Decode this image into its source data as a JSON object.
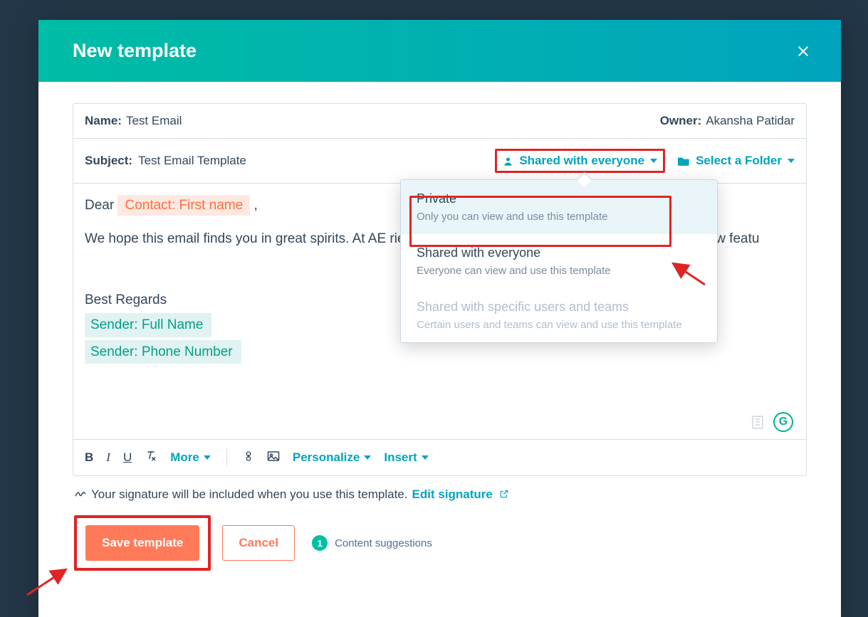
{
  "header": {
    "title": "New template"
  },
  "fields": {
    "name_label": "Name:",
    "name_value": "Test Email",
    "owner_label": "Owner:",
    "owner_value": "Akansha Patidar",
    "subject_label": "Subject:",
    "subject_value": "Test Email Template"
  },
  "sharing": {
    "current": "Shared with everyone",
    "folder_label": "Select a Folder",
    "options": [
      {
        "title": "Private",
        "desc": "Only you can view and use this template"
      },
      {
        "title": "Shared with everyone",
        "desc": "Everyone can view and use this template"
      },
      {
        "title": "Shared with specific users and teams",
        "desc": "Certain users and teams can view and use this template"
      }
    ]
  },
  "editor": {
    "greeting_prefix": "Dear ",
    "greeting_token": "Contact: First name",
    "greeting_suffix": " ,",
    "body_line": "We hope this email finds you in great spirits. At AE  rience, and we're thrilled to introduce some exciting new featu",
    "closing": "Best Regards",
    "sender_name_token": "Sender: Full Name",
    "sender_phone_token": "Sender: Phone Number"
  },
  "toolbar": {
    "more": "More",
    "personalize": "Personalize",
    "insert": "Insert"
  },
  "signature": {
    "text": "Your signature will be included when you use this template.",
    "link": "Edit signature"
  },
  "footer": {
    "save": "Save template",
    "cancel": "Cancel",
    "suggestion_count": "1",
    "suggestion_label": "Content suggestions"
  },
  "grammarly": "G"
}
